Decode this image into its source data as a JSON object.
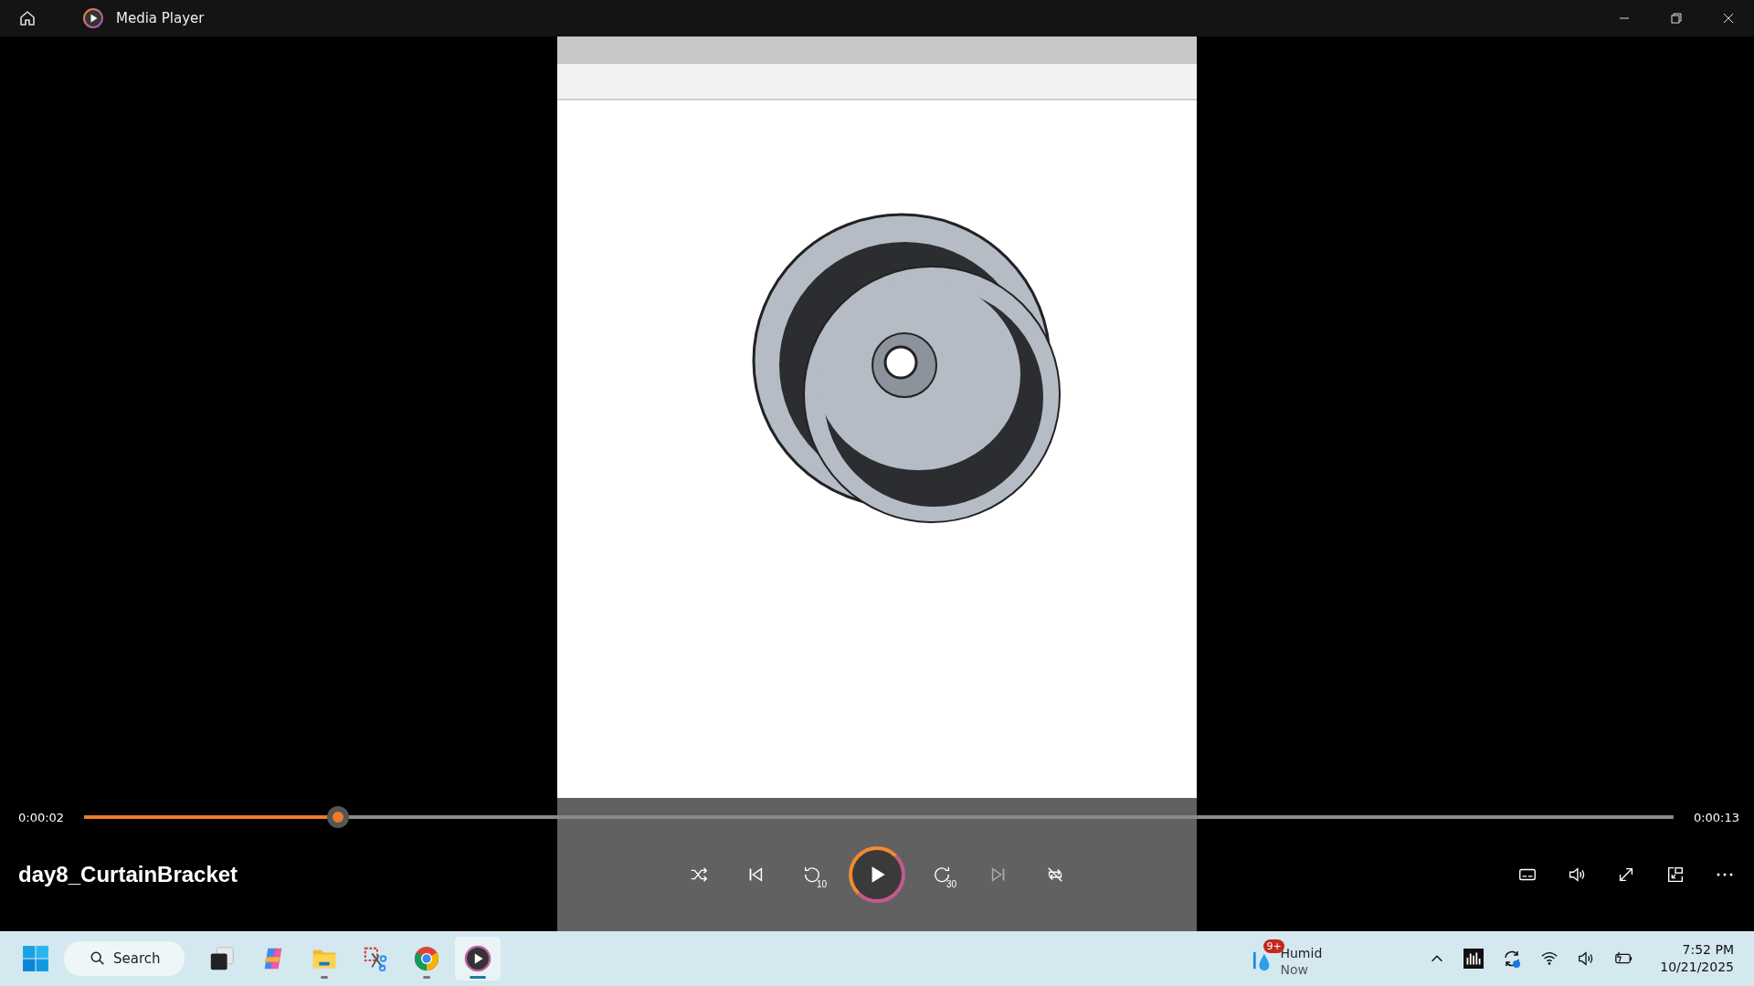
{
  "window": {
    "title": "Media Player"
  },
  "player": {
    "elapsed": "0:00:02",
    "duration": "0:00:13",
    "level": 0.16,
    "title": "day8_CurtainBracket",
    "playing": false,
    "skip_back": "10",
    "skip_forward": "30"
  },
  "taskbar": {
    "search": "Search",
    "apps": [
      {
        "kind": "task-view",
        "running": false,
        "selected": false
      },
      {
        "kind": "copilot",
        "running": false,
        "selected": false
      },
      {
        "kind": "files",
        "running": true,
        "selected": false
      },
      {
        "kind": "snipping",
        "running": false,
        "selected": false
      },
      {
        "kind": "chrome",
        "running": true,
        "selected": false
      },
      {
        "kind": "media",
        "running": true,
        "selected": true
      }
    ],
    "weather": {
      "badge": "9+",
      "condition": "Humid",
      "time": "Now"
    },
    "clock": {
      "time": "7:52 PM",
      "date": "10/21/2025"
    }
  }
}
